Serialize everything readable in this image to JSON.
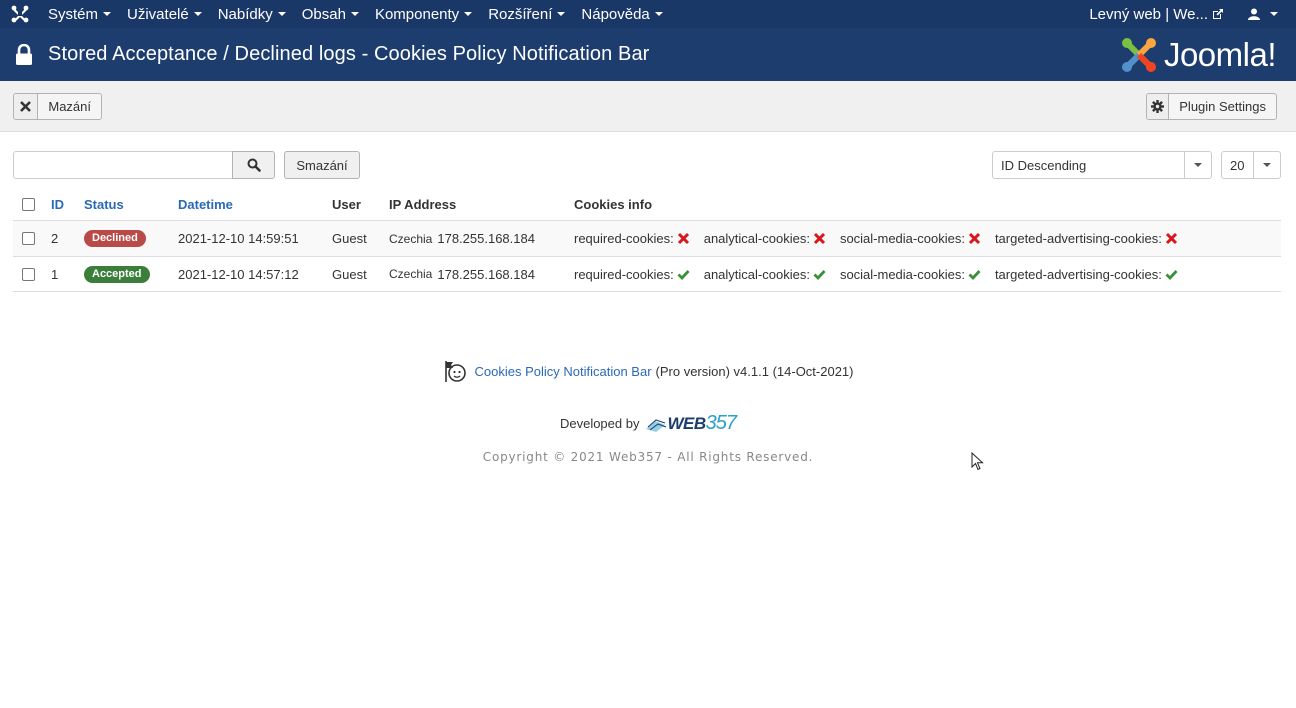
{
  "topnav": {
    "items": [
      {
        "label": "Systém"
      },
      {
        "label": "Uživatelé"
      },
      {
        "label": "Nabídky"
      },
      {
        "label": "Obsah"
      },
      {
        "label": "Komponenty"
      },
      {
        "label": "Rozšíření"
      },
      {
        "label": "Nápověda"
      }
    ],
    "site_label": "Levný web | We..."
  },
  "titlebar": {
    "title": "Stored Acceptance / Declined logs - Cookies Policy Notification Bar",
    "brand": "Joomla!"
  },
  "toolbar": {
    "delete_label": "Mazání",
    "settings_label": "Plugin Settings"
  },
  "filters": {
    "search_value": "",
    "clear_label": "Smazání",
    "ordering": "ID Descending",
    "limit": "20"
  },
  "table": {
    "headers": {
      "id": "ID",
      "status": "Status",
      "datetime": "Datetime",
      "user": "User",
      "ip": "IP Address",
      "cookies": "Cookies info"
    },
    "rows": [
      {
        "id": "2",
        "status": "Declined",
        "status_color": "#b94a48",
        "datetime": "2021-12-10 14:59:51",
        "user": "Guest",
        "country": "Czechia",
        "ip": "178.255.168.184",
        "cookies": [
          {
            "label": "required-cookies:",
            "accepted": false
          },
          {
            "label": "analytical-cookies:",
            "accepted": false
          },
          {
            "label": "social-media-cookies:",
            "accepted": false
          },
          {
            "label": "targeted-advertising-cookies:",
            "accepted": false
          }
        ]
      },
      {
        "id": "1",
        "status": "Accepted",
        "status_color": "#3a7e3a",
        "datetime": "2021-12-10 14:57:12",
        "user": "Guest",
        "country": "Czechia",
        "ip": "178.255.168.184",
        "cookies": [
          {
            "label": "required-cookies:",
            "accepted": true
          },
          {
            "label": "analytical-cookies:",
            "accepted": true
          },
          {
            "label": "social-media-cookies:",
            "accepted": true
          },
          {
            "label": "targeted-advertising-cookies:",
            "accepted": true
          }
        ]
      }
    ]
  },
  "footer": {
    "product_link": "Cookies Policy Notification Bar",
    "version_text": "(Pro version) v4.1.1 (14-Oct-2021)",
    "developed_by": "Developed by",
    "logo_text_1": "WEB",
    "logo_text_2": "357",
    "copyright": "Copyright © 2021 Web357 - All Rights Reserved."
  },
  "colors": {
    "nav_bg": "#1a3867",
    "title_bg": "#1c3d6e",
    "link": "#2a69b8",
    "declined": "#b94a48",
    "accepted": "#3a7e3a",
    "cross": "#d9161b",
    "check": "#3a8f3a"
  }
}
